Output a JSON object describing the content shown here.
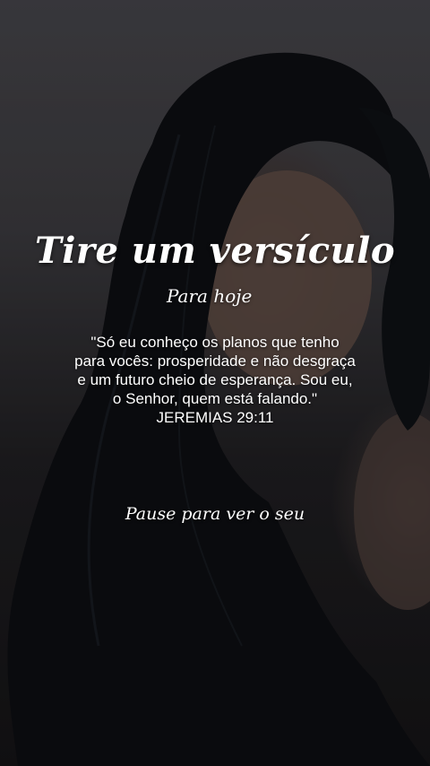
{
  "title": "Tire um versículo",
  "subtitle": "Para hoje",
  "verse": {
    "lines": [
      "\"Só eu conheço os planos que tenho",
      "para vocês: prosperidade e não desgraça",
      "e um futuro cheio de esperança. Sou eu,",
      "o Senhor, quem está falando.\""
    ],
    "reference": "JEREMIAS 29:11"
  },
  "pause_text": "Pause para ver o seu",
  "colors": {
    "text": "#ffffff",
    "background": "#2b2a2e",
    "hair": "#0c0d10"
  }
}
